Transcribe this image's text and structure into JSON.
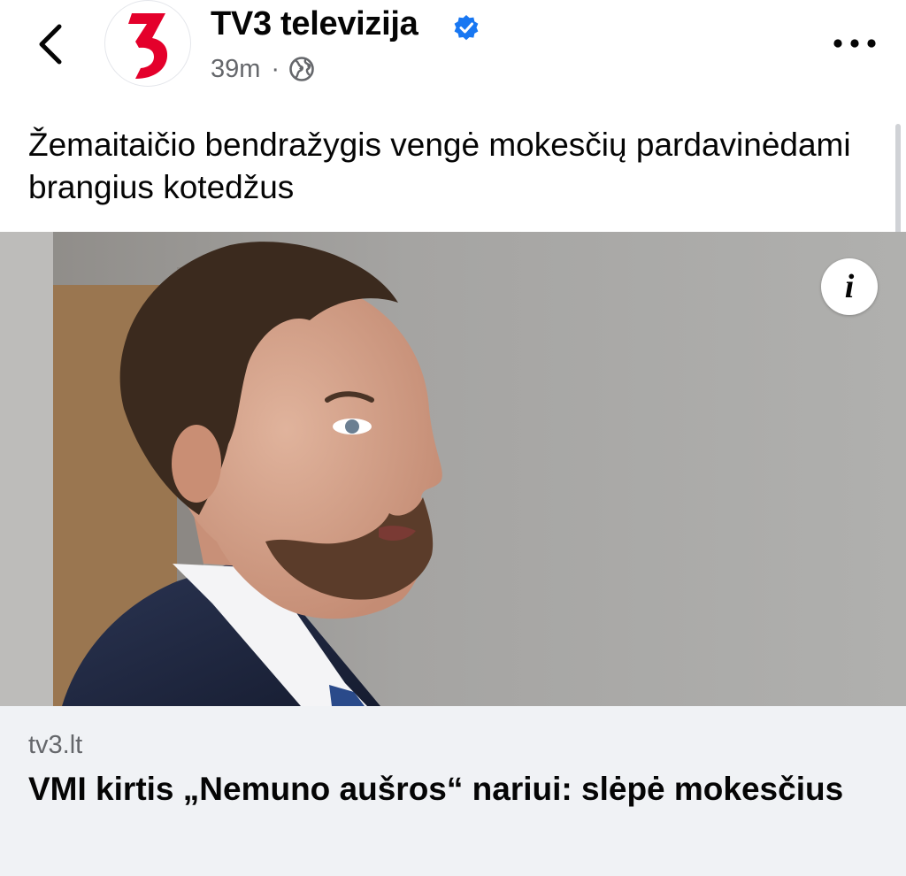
{
  "header": {
    "page_name": "TV3 televizija",
    "time_ago": "39m",
    "separator": "·",
    "avatar_brand_color": "#e4002b",
    "verified_color": "#1877f2",
    "icons": [
      "back-chevron-icon",
      "verified-badge-icon",
      "globe-icon",
      "more-options-icon"
    ]
  },
  "post": {
    "caption": "Žemaitaičio bendražygis vengė mokesčių pardavinėdami brangius kotedžus"
  },
  "link_card": {
    "domain": "tv3.lt",
    "headline": "VMI kirtis „Nemuno aušros“ nariui: slėpė mokesčius",
    "info_label": "i"
  }
}
